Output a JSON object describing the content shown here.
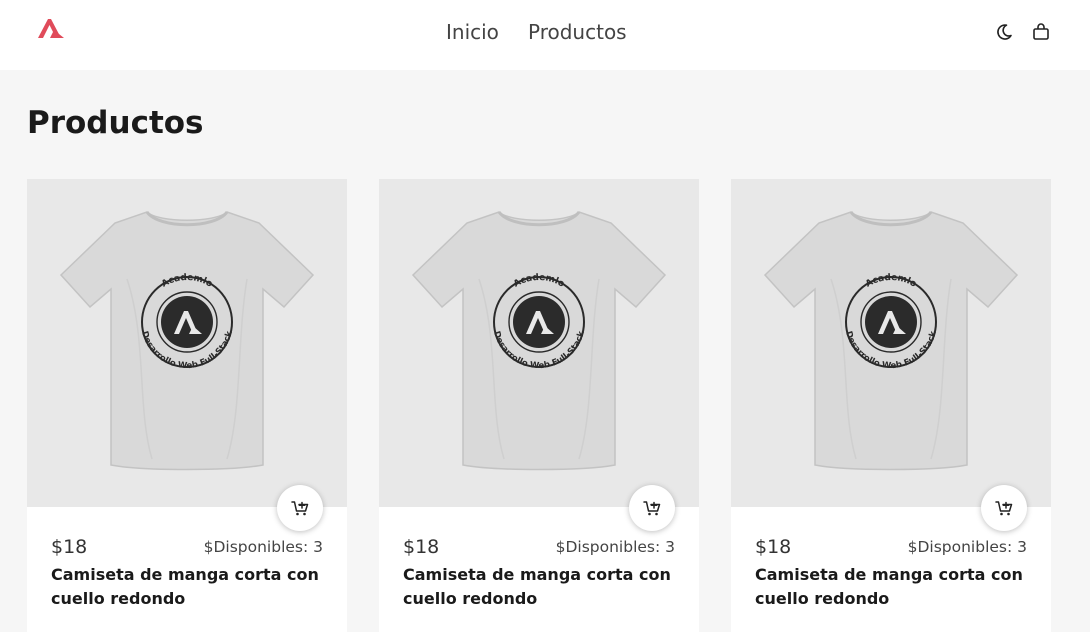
{
  "header": {
    "logo_icon": "academlo-logo-icon",
    "nav": [
      {
        "label": "Inicio"
      },
      {
        "label": "Productos"
      }
    ],
    "icons": [
      "moon-icon",
      "shopping-bag-icon"
    ]
  },
  "main": {
    "title": "Productos",
    "products": [
      {
        "price": "$18",
        "stock": "$Disponibles: 3",
        "name": "Camiseta de manga corta con cuello redondo",
        "print_top": "Academlo",
        "print_bottom": "Desarrollo Web Full-Stack"
      },
      {
        "price": "$18",
        "stock": "$Disponibles: 3",
        "name": "Camiseta de manga corta con cuello redondo",
        "print_top": "Academlo",
        "print_bottom": "Desarrollo Web Full-Stack"
      },
      {
        "price": "$18",
        "stock": "$Disponibles: 3",
        "name": "Camiseta de manga corta con cuello redondo",
        "print_top": "Academlo",
        "print_bottom": "Desarrollo Web Full-Stack"
      }
    ]
  },
  "colors": {
    "accent": "#e04b5a",
    "background": "#f6f6f6",
    "image_bg": "#e8e8e8"
  }
}
